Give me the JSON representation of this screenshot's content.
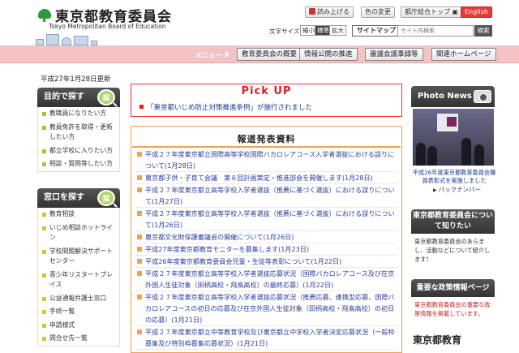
{
  "header": {
    "title": "東京都教育委員会",
    "subtitle": "Tokyo Metropolitan Board of Education",
    "read_aloud": "読み上げる",
    "color_change": "色の変更",
    "gov_top": "都庁総合トップ",
    "english": "English",
    "font_size_label": "文字サイズ",
    "size_small": "縮小",
    "size_standard": "標準",
    "size_large": "拡大",
    "sitemap": "サイトマップ",
    "search_placeholder": "サイト内検索",
    "search_button": "検索"
  },
  "nav": {
    "menu": "メニュー",
    "tabs": [
      "教育委員会の概要",
      "情報公開の推進",
      "審議会議事録等",
      "関連ホームページ"
    ]
  },
  "date": "平成27年1月28日更新",
  "left": {
    "purpose": {
      "title": "目的で探す",
      "badge": "探",
      "items": [
        "教職員になりたい方",
        "教員免許を取得・更新したい方",
        "都立学校に入りたい方",
        "相談・質問等したい方"
      ]
    },
    "window": {
      "title": "窓口を探す",
      "badge": "探",
      "items": [
        "教育相談",
        "いじめ相談ホットライン",
        "学校問題解決サポートセンター",
        "青少年リスタートプレイス",
        "公益通報弁護士窓口",
        "手続一覧",
        "申請様式",
        "問合せ先一覧"
      ]
    }
  },
  "pickup": {
    "title": "Pick UP",
    "link": "「東京都いじめ防止対策推進条例」が施行されました"
  },
  "press": {
    "title": "報道発表資料",
    "items": [
      "平成２７年度東京都立国際高等学校国際バカロレアコース入学者選抜における誤りについて(1月28日)",
      "東京都子供・子育て会議　第８回計画策定・推進部会を開催します(1月28日)",
      "平成２７年度東京都立高等学校入学者選抜（推薦に基づく選抜）における誤りについて(1月27日)",
      "平成２７年度東京都立高等学校入学者選抜（推薦に基づく選抜）における誤りについて(1月26日)",
      "東京都文化財保護審議会の開催について(1月26日)",
      "平成27年度東京都教育モニターを募集します(1月23日)",
      "平成26年度東京都教育委員会児童・生徒等表彰について(1月22日)",
      "平成２７年度東京都立高等学校入学者選抜応募状況（国際バカロレアコース及び在京外国人生徒対象（田柄高校・飛鳥高校）の最終応募）(1月22日)",
      "平成２７年度東京都立高等学校入学者選抜応募状況（推薦応募、連携型応募、国際バカロレアコースの初日の応募及び在京外国人生徒対象（田柄高校・飛鳥高校）の初日の応募）(1月21日)",
      "平成２７年度東京都立中等教育学校及び東京都立中学校入学者決定応募状況（一般枠募集及び特別枠募集応募状況）(1月21日)"
    ]
  },
  "right": {
    "photo_news": "Photo News",
    "caption": "平成26年度東京都教育委員会職員表彰式を実施しました",
    "back_number": "バックナンバー",
    "about_title": "東京都教育委員会について知りたい",
    "about_text": "東京都教育委員会のあらまし、活動などについて紹介します！",
    "policy_title": "重要な政策情報ページ",
    "policy_text": "東京都教育委員会の重要な政策情報を掲載しています。",
    "bottom": "東京都教育"
  },
  "colors": {
    "nav_pink": "#f4c4c4",
    "pickup_red": "#e02020",
    "press_orange": "#f2a24a",
    "green_accent": "#a8c23a"
  }
}
